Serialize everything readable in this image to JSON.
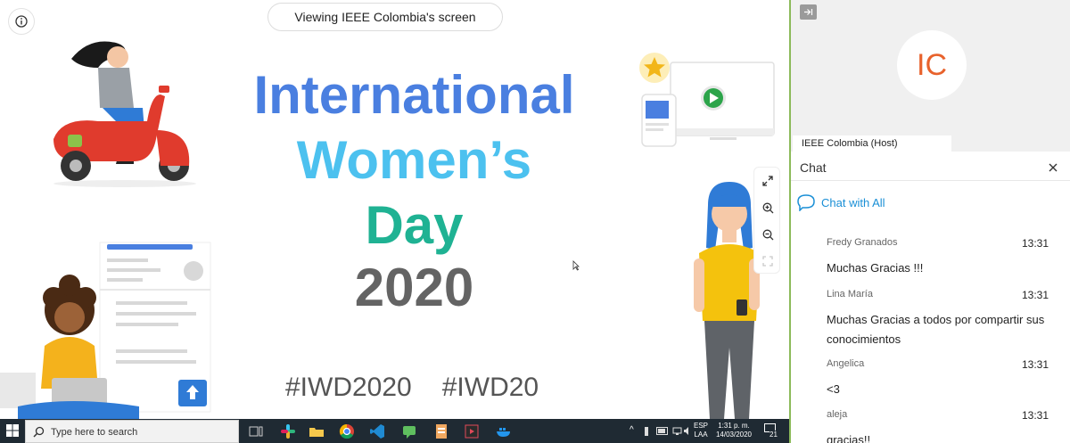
{
  "screen_share": {
    "viewing_label": "Viewing IEEE Colombia's screen",
    "slide": {
      "line1": "International",
      "line2": "Women’s",
      "line3": "Day",
      "line4": "2020",
      "hashtag1": "#IWD2020",
      "hashtag2": "#IWD20"
    }
  },
  "participant": {
    "initials": "IC",
    "name_label": "IEEE Colombia (Host)"
  },
  "chat": {
    "title": "Chat",
    "channel_label": "Chat with All",
    "messages": [
      {
        "sender": "Fredy Granados",
        "time": "13:31",
        "text": "Muchas Gracias !!!"
      },
      {
        "sender": "Lina María",
        "time": "13:31",
        "text": "Muchas Gracias a todos por compartir sus conocimientos"
      },
      {
        "sender": "Angelica",
        "time": "13:31",
        "text": "<3"
      },
      {
        "sender": "aleja",
        "time": "13:31",
        "text": "gracias!!"
      }
    ]
  },
  "taskbar": {
    "search_placeholder": "Type here to search",
    "lang_line1": "ESP",
    "lang_line2": "LAA",
    "time": "1:31 p. m.",
    "date": "14/03/2020",
    "notification_count": "21"
  },
  "colors": {
    "accent_blue": "#4a7fe0",
    "accent_cyan": "#4cc1ef",
    "accent_green": "#1fb293",
    "avatar_orange": "#e8622c",
    "panel_border": "#8cba5a",
    "link_blue": "#1a8fd6"
  }
}
